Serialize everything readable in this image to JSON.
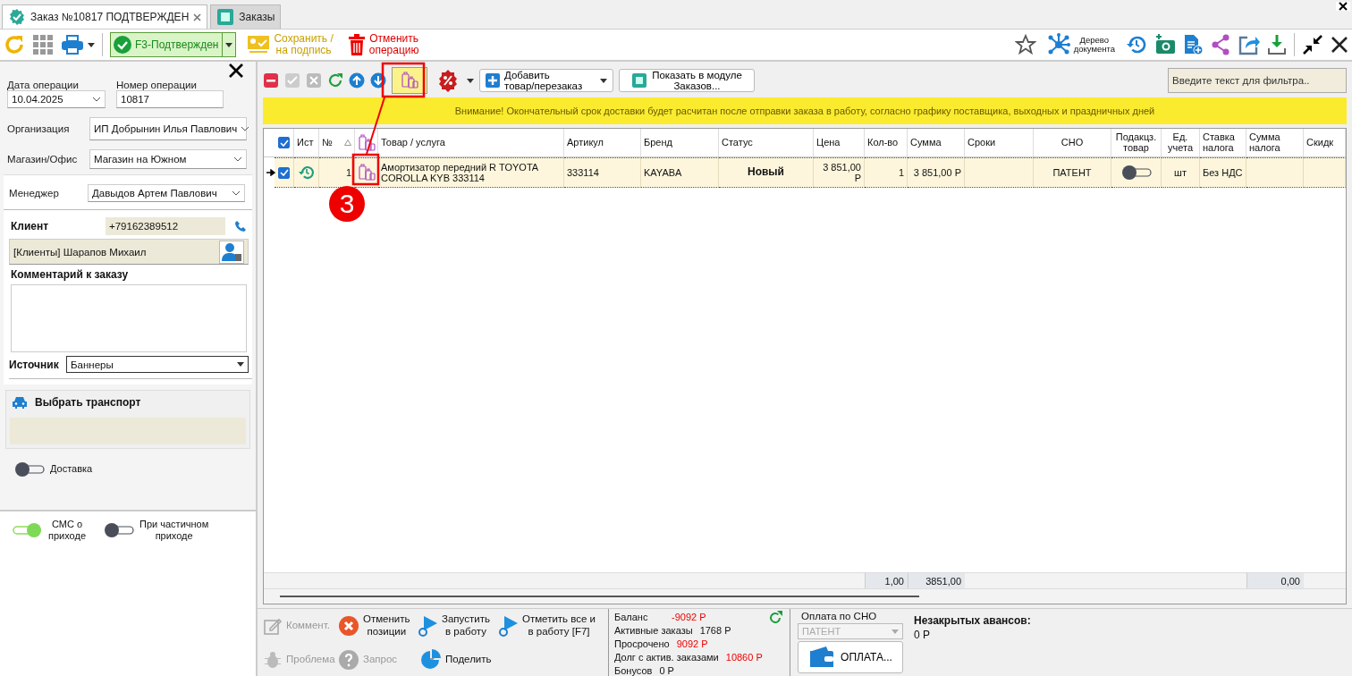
{
  "tabs": [
    {
      "label": "Заказ №10817 ПОДТВЕРЖДЕН",
      "selected": true,
      "closable": true
    },
    {
      "label": "Заказы",
      "selected": false,
      "closable": false
    }
  ],
  "toolbar": {
    "status_button": "F3-Подтвержден",
    "save_button": "Сохранить /\nна подпись",
    "cancel_button": "Отменить\nоперацию",
    "tree_button": "Дерево\nдокумента"
  },
  "form": {
    "date_label": "Дата операции",
    "date_value": "10.04.2025",
    "number_label": "Номер операции",
    "number_value": "10817",
    "organization_label": "Организация",
    "organization_value": "ИП Добрынин Илья Павлович",
    "store_label": "Магазин/Офис",
    "store_value": "Магазин на Южном",
    "manager_label": "Менеджер",
    "manager_value": "Давыдов Артем Павлович",
    "client_label": "Клиент",
    "client_phone": "+79162389512",
    "client_name": "[Клиенты] Шарапов Михаил",
    "comment_label": "Комментарий к заказу",
    "source_label": "Источник",
    "source_value": "Баннеры",
    "transport_label": "Выбрать транспорт",
    "delivery": {
      "label": "Доставка",
      "on": false
    }
  },
  "toggles": [
    {
      "label": "СМС о\nприходе",
      "on": true
    },
    {
      "label": "При частичном\nприходе",
      "on": false
    }
  ],
  "grid_toolbar": {
    "add_button": "Добавить\nтовар/перезаказ",
    "show_button": "Показать в модуле\nЗаказов...",
    "filter_placeholder": "Введите текст для фильтра.."
  },
  "banner": "Внимание! Окончательный срок доставки будет расчитан после отправки заказа в работу, согласно графику поставщика, выходных и праздничных дней",
  "table": {
    "header_checked": true,
    "columns": [
      {
        "kind": "text",
        "label": "Ист"
      },
      {
        "kind": "sort",
        "label": "№"
      },
      {
        "kind": "icon"
      },
      {
        "kind": "text",
        "label": "Товар / услуга"
      },
      {
        "kind": "text",
        "label": "Артикул"
      },
      {
        "kind": "text",
        "label": "Бренд"
      },
      {
        "kind": "text",
        "label": "Статус"
      },
      {
        "kind": "text",
        "label": "Цена"
      },
      {
        "kind": "text",
        "label": "Кол-во"
      },
      {
        "kind": "text",
        "label": "Сумма"
      },
      {
        "kind": "text",
        "label": "Сроки"
      },
      {
        "kind": "center",
        "label": "СНО"
      },
      {
        "kind": "center",
        "label": "Подакцз.\nтовар"
      },
      {
        "kind": "center",
        "label": "Ед.\nучета"
      },
      {
        "kind": "text",
        "label": "Ставка\nналога"
      },
      {
        "kind": "text",
        "label": "Сумма\nналога"
      },
      {
        "kind": "text",
        "label": "Скидк"
      }
    ],
    "rows": [
      {
        "current": true,
        "checked": true,
        "number": "1",
        "product": "Амортизатор передний R TOYOTA\nCOROLLA KYB 333114",
        "article": "333114",
        "brand": "KAYABA",
        "status": "Новый",
        "price": "3 851,00\nР",
        "qty": "1",
        "sum": "3 851,00 Р",
        "sno": "ПАТЕНТ",
        "excise": false,
        "unit": "шт",
        "tax_rate": "Без НДС"
      }
    ],
    "totals": {
      "qty": "1,00",
      "sum": "3851,00",
      "tax_sum": "0,00"
    }
  },
  "actions": [
    {
      "kind": "edit",
      "label": "Коммент.",
      "disabled": true
    },
    {
      "kind": "cancel",
      "label": "Отменить\nпозиции",
      "disabled": false
    },
    {
      "kind": "run",
      "label": "Запустить\nв работу",
      "disabled": false
    },
    {
      "kind": "run",
      "label": "Отметить все и\nв работу [F7]",
      "disabled": false
    },
    {
      "kind": "bug",
      "label": "Проблема",
      "disabled": true
    },
    {
      "kind": "question",
      "label": "Запрос",
      "disabled": true
    },
    {
      "kind": "split",
      "label": "Поделить",
      "disabled": false
    }
  ],
  "balance": [
    {
      "label": "Баланс",
      "value": "-9092 Р",
      "alert": true
    },
    {
      "label": "Активные заказы",
      "value": "1768 Р",
      "alert": false
    },
    {
      "label": "Просрочено",
      "value": "9092 Р",
      "alert": true
    },
    {
      "label": "Долг с актив. заказами",
      "value": "10860 Р",
      "alert": true
    },
    {
      "label": "Бонусов",
      "value": "0 Р",
      "alert": false
    }
  ],
  "payment": {
    "label": "Оплата  по СНО",
    "sno_value": "ПАТЕНТ",
    "pay_button": "ОПЛАТА...",
    "advances_label": "Незакрытых авансов:",
    "advances_value": "0 Р"
  },
  "annotation": {
    "step": "3"
  }
}
